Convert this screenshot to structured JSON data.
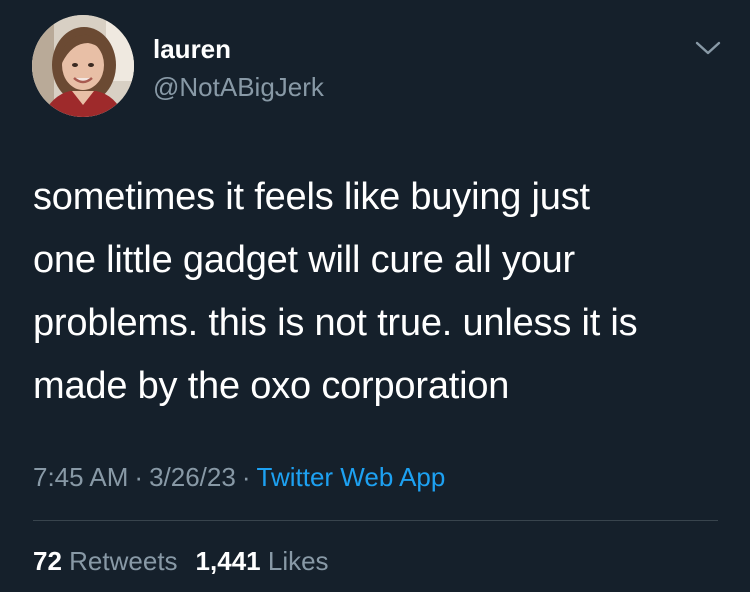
{
  "author": {
    "name": "lauren",
    "handle": "@NotABigJerk",
    "avatar_icon": "profile-photo"
  },
  "menu": {
    "icon": "chevron-down-icon"
  },
  "tweet": {
    "text": "sometimes it feels like buying just\none little gadget will cure all your\nproblems. this is not true. unless it is\nmade by the oxo corporation",
    "time": "7:45 AM",
    "separator": "·",
    "date": "3/26/23",
    "source": "Twitter Web App"
  },
  "stats": {
    "retweets_count": "72",
    "retweets_label": "Retweets",
    "likes_count": "1,441",
    "likes_label": "Likes"
  },
  "colors": {
    "background": "#15202b",
    "primary_text": "#ffffff",
    "secondary_text": "#8899a6",
    "link": "#1da1f2",
    "divider": "#38444d"
  }
}
